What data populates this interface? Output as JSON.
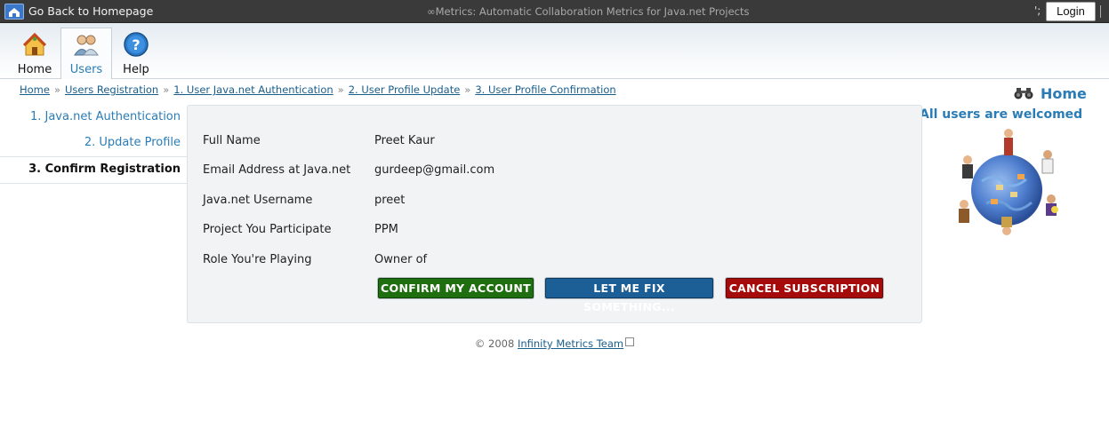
{
  "topbar": {
    "back_label": "Go Back to Homepage",
    "app_title": "∞Metrics: Automatic Collaboration Metrics for Java.net Projects",
    "separator": "';",
    "login_label": "Login"
  },
  "nav": {
    "items": [
      {
        "label": "Home",
        "icon": "home-icon"
      },
      {
        "label": "Users",
        "icon": "users-icon"
      },
      {
        "label": "Help",
        "icon": "help-icon"
      }
    ],
    "active": "Users"
  },
  "breadcrumb": [
    "Home",
    "Users Registration",
    "1. User Java.net Authentication",
    "2. User Profile Update",
    "3. User Profile Confirmation"
  ],
  "sidebar_right": {
    "home_label": "Home",
    "welcome": "All users are welcomed"
  },
  "steps": [
    {
      "label": "1. Java.net Authentication"
    },
    {
      "label": "2. Update Profile"
    },
    {
      "label": "3. Confirm Registration"
    }
  ],
  "profile": {
    "rows": [
      {
        "key": "Full Name",
        "value": "Preet Kaur"
      },
      {
        "key": "Email Address at Java.net",
        "value": "gurdeep@gmail.com"
      },
      {
        "key": "Java.net Username",
        "value": "preet"
      },
      {
        "key": "Project You Participate",
        "value": "PPM"
      },
      {
        "key": "Role You're Playing",
        "value": "Owner of"
      }
    ]
  },
  "buttons": {
    "confirm": "CONFIRM MY ACCOUNT",
    "fix": "LET ME FIX SOMETHING...",
    "cancel": "CANCEL SUBSCRIPTION"
  },
  "footer": {
    "copyright": "© 2008",
    "link": "Infinity Metrics Team"
  },
  "colors": {
    "accent": "#2a7cb6",
    "confirm": "#1f6e0f",
    "fix": "#1b5f96",
    "cancel": "#a50b0b"
  }
}
